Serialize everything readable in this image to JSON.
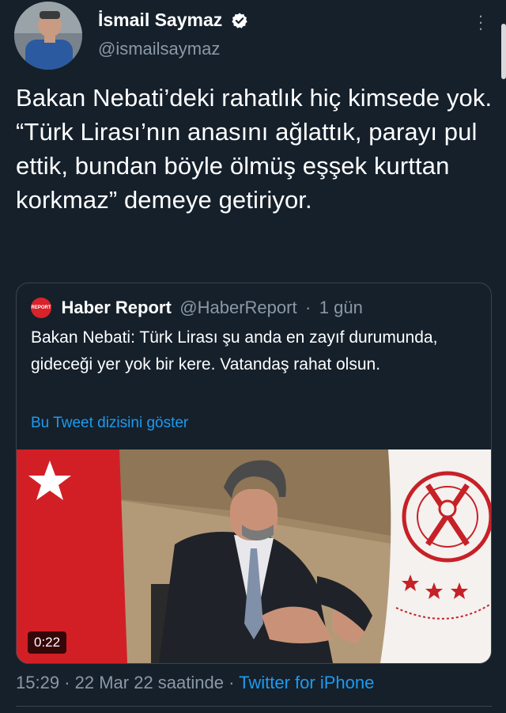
{
  "author": {
    "display_name": "İsmail Saymaz",
    "handle": "@ismailsaymaz",
    "avatar_icon": "profile-photo",
    "verified_icon": "verified-badge-icon"
  },
  "tweet": {
    "text": "Bakan Nebati’deki rahatlık hiç kimsede yok. “Türk Lirası’nın anasını ağlattık, parayı pul ettik, bundan böyle ölmüş eşşek kurttan korkmaz” demeye getiriyor."
  },
  "quoted_tweet": {
    "logo_text": "REPORT",
    "display_name": "Haber Report",
    "handle": "@HaberReport",
    "separator": "·",
    "time": "1 gün",
    "text": "Bakan Nebati: Türk Lirası şu anda en zayıf durumunda, gideceği yer yok bir kere. Vatandaş rahat olsun.",
    "show_thread_label": "Bu Tweet dizisini göster",
    "video_duration": "0:22"
  },
  "footer": {
    "time": "15:29",
    "sep1": "·",
    "date": "22 Mar 22 saatinde",
    "sep2": "·",
    "source": "Twitter for iPhone"
  },
  "colors": {
    "background": "#15202b",
    "text": "#ffffff",
    "secondary": "#8b98a5",
    "link": "#1d9bf0",
    "border": "#38444d",
    "verified": "#ffffff"
  }
}
